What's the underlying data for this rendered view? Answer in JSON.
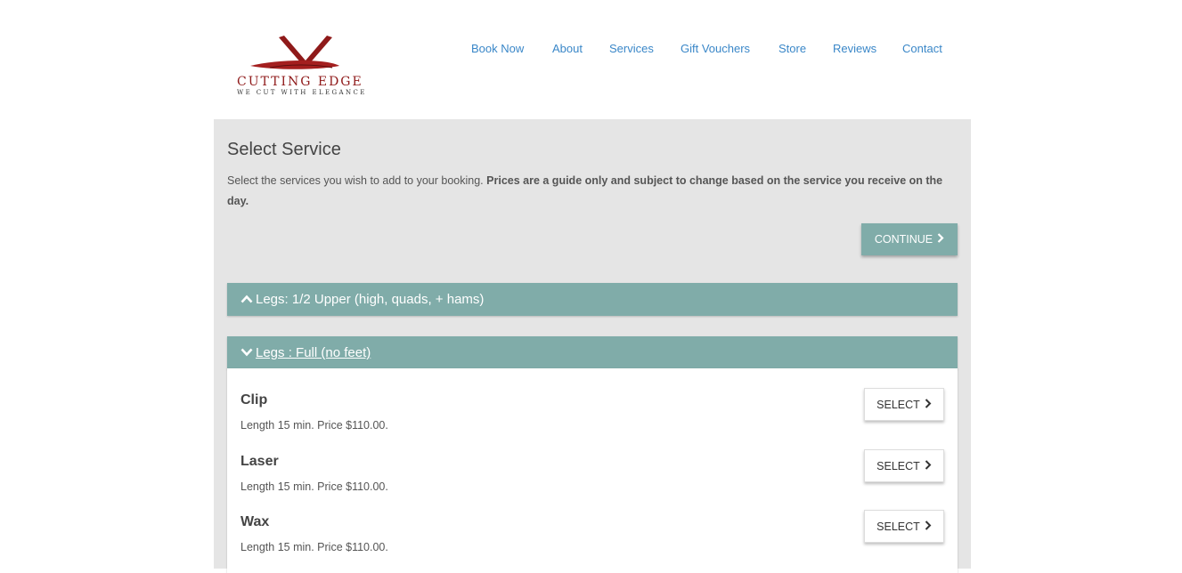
{
  "brand": {
    "name": "CUTTING EDGE",
    "tagline": "WE CUT WITH ELEGANCE",
    "logo_color": "#8f1a1a"
  },
  "nav": {
    "items": [
      {
        "label": "Book Now"
      },
      {
        "label": "About"
      },
      {
        "label": "Services"
      },
      {
        "label": "Gift Vouchers"
      },
      {
        "label": "Store"
      },
      {
        "label": "Reviews"
      },
      {
        "label": "Contact"
      }
    ],
    "link_color": "#3a87c8"
  },
  "page": {
    "title": "Select Service",
    "intro_plain": "Select the services you wish to add to your booking. ",
    "intro_bold": "Prices are a guide only and subject to change based on the service you receive on the day.",
    "continue_label": "CONTINUE",
    "accent_color": "#80aca9"
  },
  "categories": [
    {
      "label": "Legs: 1/2 Upper (high, quads, + hams)",
      "state": "collapsed",
      "icon": "chevron-up-icon"
    },
    {
      "label": "Legs : Full (no feet)",
      "state": "expanded",
      "icon": "chevron-down-icon"
    }
  ],
  "services": [
    {
      "name": "Clip",
      "meta": "Length 15 min. Price $110.00.",
      "button": "SELECT"
    },
    {
      "name": "Laser",
      "meta": "Length 15 min. Price $110.00.",
      "button": "SELECT"
    },
    {
      "name": "Wax",
      "meta": "Length 15 min. Price $110.00.",
      "button": "SELECT"
    }
  ]
}
